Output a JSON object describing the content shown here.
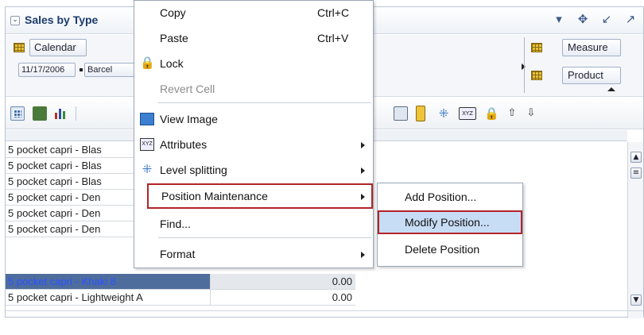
{
  "panel": {
    "title": "Sales by Type",
    "pivot": {
      "row_chip": "Calendar",
      "page_date": "11/17/2006",
      "page_store": "Barcel",
      "measure_chip": "Measure",
      "product_chip": "Product"
    }
  },
  "context_menu": {
    "items": [
      {
        "label": "Copy",
        "shortcut": "Ctrl+C"
      },
      {
        "label": "Paste",
        "shortcut": "Ctrl+V"
      },
      {
        "label": "Lock",
        "icon": "lock-icon"
      },
      {
        "label": "Revert Cell",
        "disabled": true
      },
      {
        "label": "View Image",
        "icon": "image-icon"
      },
      {
        "label": "Attributes",
        "icon": "attributes-icon"
      },
      {
        "label": "Level splitting",
        "icon": "level-splitting-icon"
      },
      {
        "label": "Position Maintenance"
      },
      {
        "label": "Find..."
      },
      {
        "label": "Format"
      }
    ]
  },
  "submenu": {
    "items": [
      "Add Position...",
      "Modify Position...",
      "Delete Position"
    ]
  },
  "grid": {
    "rows": [
      {
        "label": "5 pocket capri - Blas",
        "value": ""
      },
      {
        "label": "5 pocket capri - Blas",
        "value": ""
      },
      {
        "label": "5 pocket capri - Blas",
        "value": ""
      },
      {
        "label": "5 pocket capri - Den",
        "value": ""
      },
      {
        "label": "5 pocket capri - Den",
        "value": ""
      },
      {
        "label": "5 pocket capri - Den",
        "value": ""
      },
      {
        "label": "5 pocket capri - Khaki 8",
        "value": "0.00"
      },
      {
        "label": "5 pocket capri - Lightweight A",
        "value": "0.00"
      }
    ]
  },
  "colors": {
    "highlight_border": "#b22428",
    "hover_bg": "#c7dcf5",
    "selected_row_bg": "#4f6d9c",
    "title_color": "#1c3b6c"
  }
}
